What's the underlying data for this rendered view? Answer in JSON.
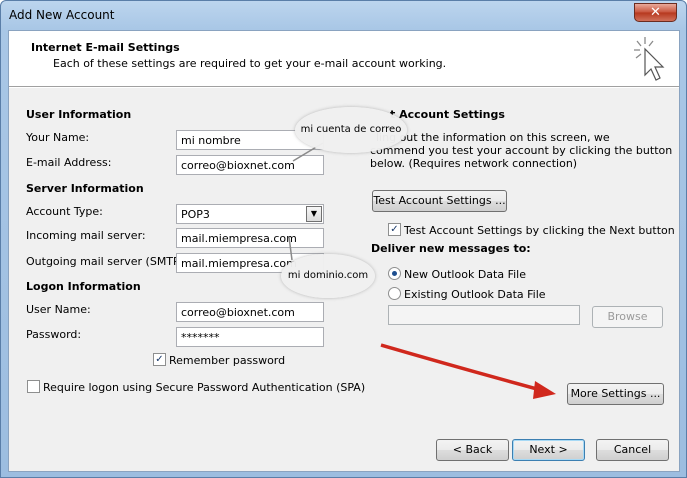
{
  "window": {
    "title": "Add New Account",
    "close_glyph": "✕"
  },
  "header": {
    "title": "Internet E-mail Settings",
    "subtitle": "Each of these settings are required to get your e-mail account working.",
    "icon": "cursor-sparkle-icon"
  },
  "user_info": {
    "heading": "User Information",
    "name_label": "Your Name:",
    "name_value": "mi nombre",
    "email_label": "E-mail Address:",
    "email_value": "correo@bioxnet.com"
  },
  "server_info": {
    "heading": "Server Information",
    "account_type_label": "Account Type:",
    "account_type_value": "POP3",
    "incoming_label": "Incoming mail server:",
    "incoming_value": "mail.miempresa.com",
    "outgoing_label": "Outgoing mail server (SMTP):",
    "outgoing_value": "mail.miempresa.com"
  },
  "logon_info": {
    "heading": "Logon Information",
    "user_label": "User Name:",
    "user_value": "correo@bioxnet.com",
    "password_label": "Password:",
    "password_value": "*******",
    "remember_label": "Remember password",
    "remember_checked": true,
    "spa_label": "Require logon using Secure Password Authentication (SPA)",
    "spa_checked": false
  },
  "test_settings": {
    "heading_visible": "t Account Settings",
    "desc_line1": "ling out the information on this screen, we",
    "desc_line2": "commend you test your account by clicking the button",
    "desc_line3": "below. (Requires network connection)",
    "test_button": "Test Account Settings ...",
    "auto_test_label": "Test Account Settings by clicking the Next button",
    "auto_test_checked": true
  },
  "deliver": {
    "heading": "Deliver new messages to:",
    "option_new": "New Outlook Data File",
    "option_existing": "Existing Outlook Data File",
    "selected": "new",
    "existing_path": "",
    "browse_button": "Browse"
  },
  "more_settings_button": "More Settings ...",
  "footer": {
    "back": "< Back",
    "next": "Next >",
    "cancel": "Cancel"
  },
  "annotations": {
    "bubble_account": "mi cuenta de correo",
    "bubble_domain": "mi dominio.com",
    "arrow_color": "#d0281d"
  }
}
